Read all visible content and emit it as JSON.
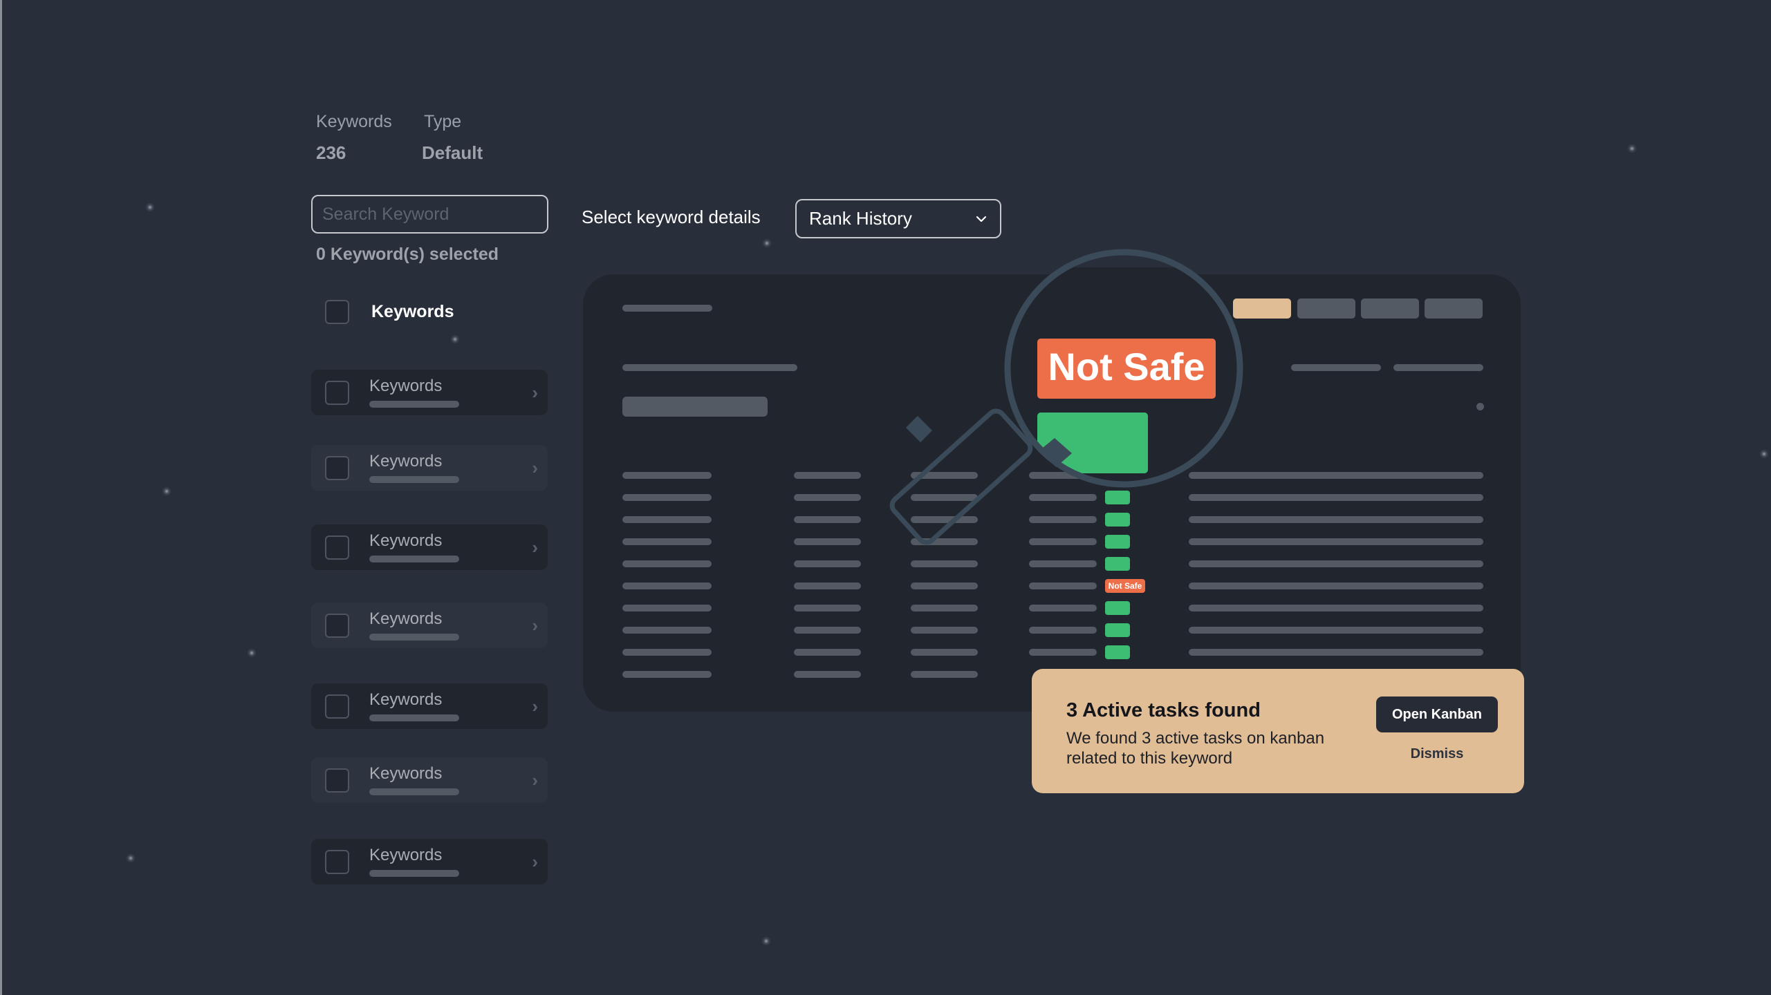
{
  "stats": {
    "keywords_label": "Keywords",
    "keywords_value": "236",
    "type_label": "Type",
    "type_value": "Default"
  },
  "search": {
    "placeholder": "Search Keyword",
    "value": "",
    "icon": "search-icon"
  },
  "selection": {
    "count_text": "0 Keyword(s) selected"
  },
  "keyword_list": {
    "header_label": "Keywords",
    "rows": [
      {
        "label": "Keywords",
        "style": "dark"
      },
      {
        "label": "Keywords",
        "style": "light"
      },
      {
        "label": "Keywords",
        "style": "dark"
      },
      {
        "label": "Keywords",
        "style": "light"
      },
      {
        "label": "Keywords",
        "style": "dark"
      },
      {
        "label": "Keywords",
        "style": "light"
      },
      {
        "label": "Keywords",
        "style": "dark"
      }
    ]
  },
  "details": {
    "label": "Select keyword details",
    "dropdown_value": "Rank History",
    "dropdown_icon": "chevron-down-icon"
  },
  "preview": {
    "magnified_badge": "Not Safe",
    "row_badge": "Not Safe",
    "safety_column": [
      "not-safe",
      "safe",
      "safe",
      "safe",
      "safe",
      "not-safe",
      "safe",
      "safe",
      "safe",
      "safe"
    ],
    "tabs_active_index": 0,
    "tab_count": 4
  },
  "notification": {
    "title": "3 Active tasks found",
    "body": "We found 3 active tasks on kanban related to this keyword",
    "primary_button": "Open Kanban",
    "secondary_button": "Dismiss"
  },
  "colors": {
    "background": "#282e3a",
    "card": "#21252e",
    "accent_peach": "#e0bd95",
    "danger": "#ec6f4a",
    "success": "#3dbd74",
    "placeholder_bar": "#535a64",
    "magnifier": "#3b4a58"
  }
}
